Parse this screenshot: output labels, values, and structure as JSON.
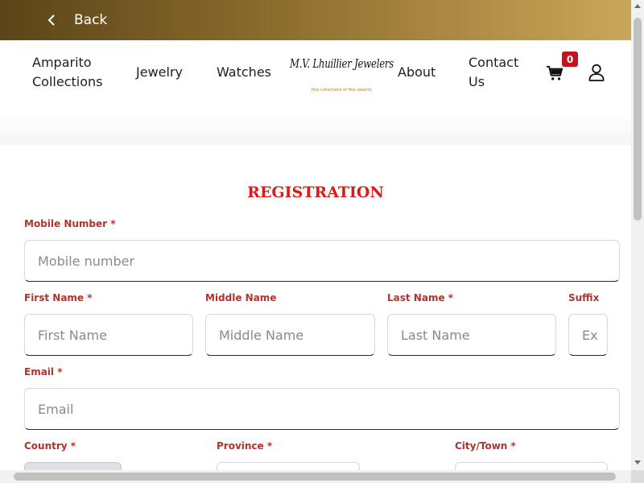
{
  "topbar": {
    "back_label": "Back"
  },
  "nav": {
    "amparito_line1": "Amparito",
    "amparito_line2": "Collections",
    "jewelry": "Jewelry",
    "watches": "Watches",
    "about": "About",
    "contact_line1": "Contact",
    "contact_line2": "Us",
    "cart_count": "0"
  },
  "logo": {
    "script": "M.V. Lhuillier Jewelers",
    "tagline": "fine collections of fine jewelry"
  },
  "form": {
    "title": "REGISTRATION",
    "mobile": {
      "label": "Mobile Number *",
      "placeholder": "Mobile number"
    },
    "first_name": {
      "label": "First Name *",
      "placeholder": "First Name"
    },
    "middle_name": {
      "label": "Middle Name",
      "placeholder": "Middle Name"
    },
    "last_name": {
      "label": "Last Name *",
      "placeholder": "Last Name"
    },
    "suffix": {
      "label": "Suffix",
      "placeholder": "Ex"
    },
    "email": {
      "label": "Email *",
      "placeholder": "Email"
    },
    "country": {
      "label": "Country *"
    },
    "province": {
      "label": "Province *"
    },
    "city": {
      "label": "City/Town *"
    }
  },
  "colors": {
    "accent_gold": "#c9a75a",
    "label_red": "#b5322b",
    "title_red": "#d81b1b",
    "badge_red": "#c0151c"
  }
}
